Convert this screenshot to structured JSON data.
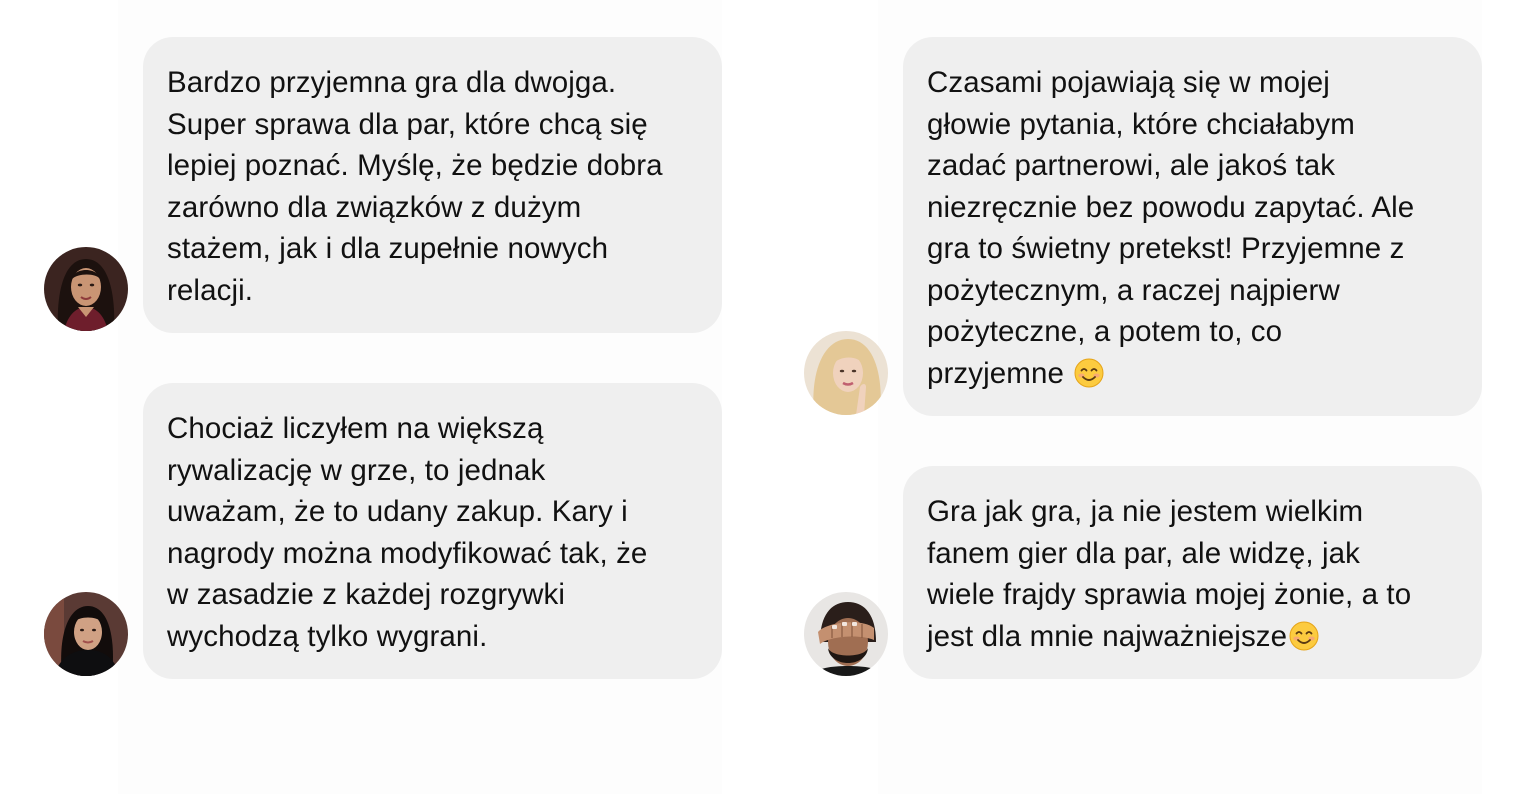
{
  "reviews": [
    {
      "avatar": "woman-dark-hair-avatar",
      "text": "Bardzo przyjemna gra dla dwojga.\nSuper sprawa dla par, które chcą się\nlepiej poznać. Myślę, że będzie dobra\nzarówno dla związków z dużym\nstażem, jak i dla zupełnie nowych\nrelacji.",
      "emoji": null
    },
    {
      "avatar": "woman-dark-hair-black-jacket-avatar",
      "text": "Chociaż liczyłem na większą\nrywalizację w grze, to jednak\nuważam, że to udany zakup. Kary i\nnagrody można modyfikować tak, że\nw zasadzie z każdej rozgrywki\nwychodzą tylko wygrani.",
      "emoji": null
    },
    {
      "avatar": "woman-blonde-hair-avatar",
      "text": "Czasami pojawiają się w mojej\ngłowie pytania, które chciałabym\nzadać partnerowi, ale jakoś tak\nniezręcznie bez powodu zapytać. Ale\ngra to świetny pretekst! Przyjemne z\npożytecznym, a raczej najpierw\npożyteczne, a potem to, co\nprzyjemne ",
      "emoji": "smiling-face-emoji"
    },
    {
      "avatar": "man-covering-face-avatar",
      "text": "Gra jak gra, ja nie jestem wielkim\nfanem gier dla par, ale widzę, jak\nwiele frajdy sprawia mojej żonie, a to\njest dla mnie najważniejsze",
      "emoji": "smiling-face-emoji"
    }
  ],
  "colors": {
    "bubble_background": "#efefef",
    "text": "#111111",
    "page_background": "#ffffff"
  }
}
